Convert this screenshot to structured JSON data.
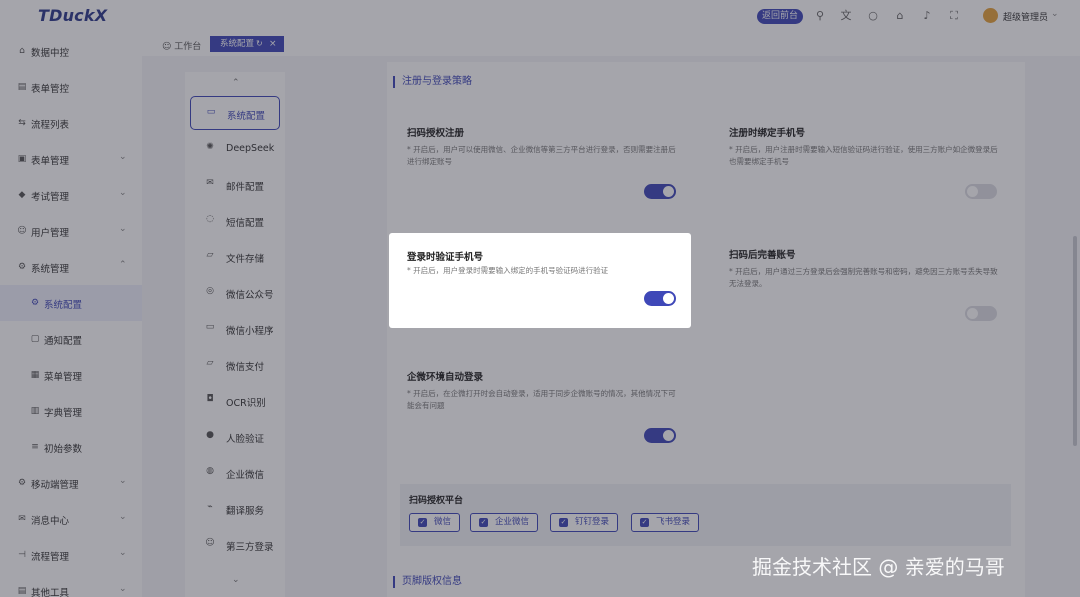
{
  "app": {
    "logo": "TDuckX"
  },
  "header": {
    "back_button": "返回前台",
    "user_name": "超级管理员"
  },
  "sidebar": {
    "items": [
      {
        "label": "数据中控",
        "icon": "home-icon"
      },
      {
        "label": "表单管控",
        "icon": "form-icon"
      },
      {
        "label": "流程列表",
        "icon": "flow-icon"
      },
      {
        "label": "表单管理",
        "icon": "form-manage-icon"
      },
      {
        "label": "考试管理",
        "icon": "exam-icon"
      },
      {
        "label": "用户管理",
        "icon": "user-icon"
      },
      {
        "label": "系统管理",
        "icon": "gear-icon"
      },
      {
        "label": "系统配置",
        "icon": "gear-icon"
      },
      {
        "label": "通知配置",
        "icon": "notify-icon"
      },
      {
        "label": "菜单管理",
        "icon": "menu-icon"
      },
      {
        "label": "字典管理",
        "icon": "dict-icon"
      },
      {
        "label": "初始参数",
        "icon": "list-icon"
      },
      {
        "label": "移动端管理",
        "icon": "mobile-icon"
      },
      {
        "label": "消息中心",
        "icon": "message-icon"
      },
      {
        "label": "流程管理",
        "icon": "process-icon"
      },
      {
        "label": "其他工具",
        "icon": "tool-icon"
      }
    ]
  },
  "tabs": {
    "home": "工作台",
    "active": "系统配置"
  },
  "config_menu": {
    "items": [
      {
        "label": "系统配置",
        "icon": "monitor-icon"
      },
      {
        "label": "DeepSeek",
        "icon": "ai-icon"
      },
      {
        "label": "邮件配置",
        "icon": "mail-icon"
      },
      {
        "label": "短信配置",
        "icon": "sms-icon"
      },
      {
        "label": "文件存储",
        "icon": "folder-icon"
      },
      {
        "label": "微信公众号",
        "icon": "wechat-icon"
      },
      {
        "label": "微信小程序",
        "icon": "miniapp-icon"
      },
      {
        "label": "微信支付",
        "icon": "pay-icon"
      },
      {
        "label": "OCR识别",
        "icon": "camera-icon"
      },
      {
        "label": "人脸验证",
        "icon": "face-icon"
      },
      {
        "label": "企业微信",
        "icon": "wecom-icon"
      },
      {
        "label": "翻译服务",
        "icon": "translate-icon"
      },
      {
        "label": "第三方登录",
        "icon": "login-icon"
      }
    ]
  },
  "main": {
    "section_register": "注册与登录策略",
    "section_footer": "页脚版权信息",
    "settings": {
      "scan_register": {
        "title": "扫码授权注册",
        "desc": "* 开启后，用户可以使用微信、企业微信等第三方平台进行登录，否则需要注册后进行绑定账号",
        "enabled": true
      },
      "bind_phone_register": {
        "title": "注册时绑定手机号",
        "desc": "* 开启后，用户注册时需要输入短信验证码进行验证，使用三方账户如企微登录后也需要绑定手机号",
        "enabled": false
      },
      "complete_account": {
        "title": "扫码后完善账号",
        "desc": "* 开启后，用户通过三方登录后会强制完善账号和密码，避免因三方账号丢失导致无法登录。",
        "enabled": false
      },
      "wecom_auto_login": {
        "title": "企微环境自动登录",
        "desc": "* 开启后，在企微打开时会自动登录，适用于同步企微账号的情况，其他情况下可能会有问题",
        "enabled": true
      }
    },
    "platform": {
      "label": "扫码授权平台",
      "chips": [
        "微信",
        "企业微信",
        "钉钉登录",
        "飞书登录"
      ]
    }
  },
  "popup": {
    "title": "登录时验证手机号",
    "desc": "* 开启后，用户登录时需要输入绑定的手机号验证码进行验证",
    "enabled": true
  },
  "watermark": "掘金技术社区 @ 亲爱的马哥"
}
